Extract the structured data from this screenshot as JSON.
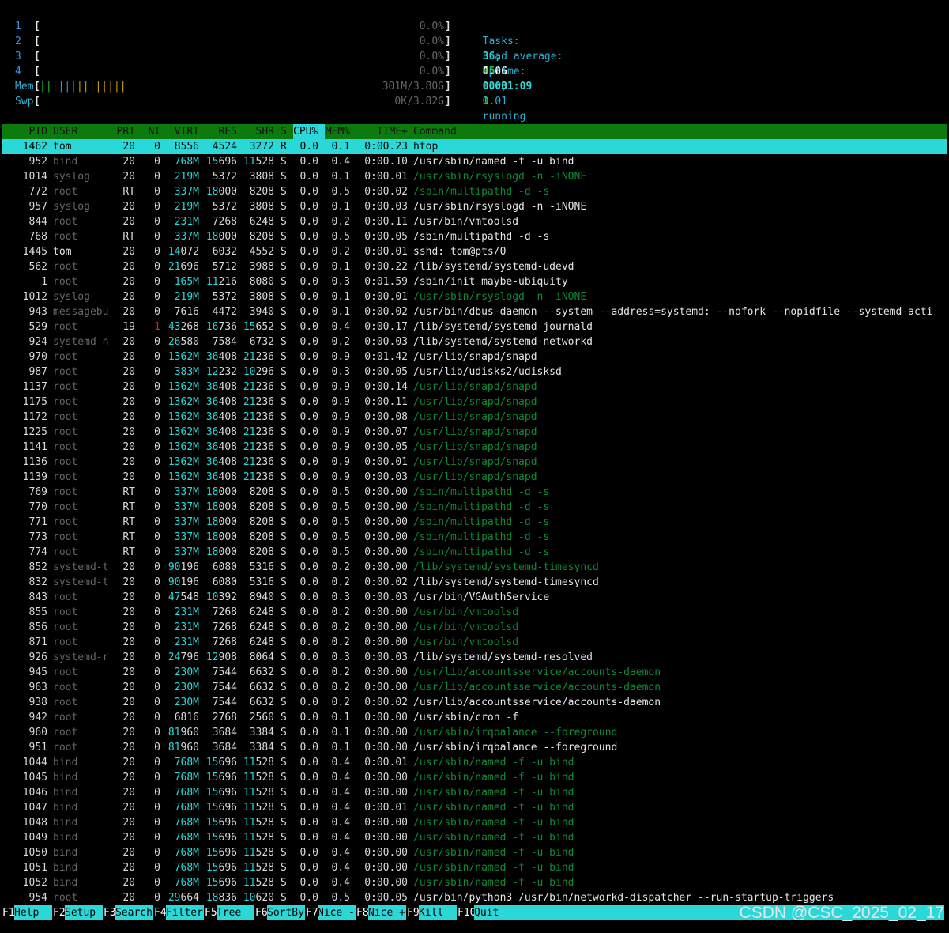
{
  "cpus": [
    {
      "num": "1",
      "pct": "0.0%"
    },
    {
      "num": "2",
      "pct": "0.0%"
    },
    {
      "num": "3",
      "pct": "0.0%"
    },
    {
      "num": "4",
      "pct": "0.0%"
    }
  ],
  "mem": {
    "label": "Mem",
    "bar": "||||||||||||||",
    "value": "301M/3.80G"
  },
  "swp": {
    "label": "Swp",
    "value": "0K/3.82G"
  },
  "tasks": {
    "label": "Tasks:",
    "tasks": "36,",
    "thr": "45",
    "thr_label": "thr;",
    "running": "1",
    "running_label": "running"
  },
  "load": {
    "label": "Load average:",
    "l1": "0.06",
    "l5": "0.03",
    "l15": "0.01"
  },
  "uptime": {
    "label": "Uptime:",
    "value": "00:01:09"
  },
  "columns": [
    "PID",
    "USER",
    "PRI",
    "NI",
    "VIRT",
    "RES",
    "SHR",
    "S",
    "CPU%",
    "MEM%",
    "TIME+",
    "Command"
  ],
  "processes": [
    {
      "pid": "1462",
      "user": "tom",
      "pri": "20",
      "ni": "0",
      "virt": "8556",
      "res": "4524",
      "shr": "3272",
      "s": "R",
      "cpu": "0.0",
      "mem": "0.1",
      "time": "0:00.23",
      "cmd": "htop",
      "sel": true
    },
    {
      "pid": "952",
      "user": "bind",
      "pri": "20",
      "ni": "0",
      "virt": "768M",
      "res": "15696",
      "shr": "11528",
      "s": "S",
      "cpu": "0.0",
      "mem": "0.4",
      "time": "0:00.10",
      "cmd": "/usr/sbin/named -f -u bind"
    },
    {
      "pid": "1014",
      "user": "syslog",
      "pri": "20",
      "ni": "0",
      "virt": "219M",
      "res": "5372",
      "shr": "3808",
      "s": "S",
      "cpu": "0.0",
      "mem": "0.1",
      "time": "0:00.01",
      "cmd": "/usr/sbin/rsyslogd -n -iNONE",
      "thread": true
    },
    {
      "pid": "772",
      "user": "root",
      "pri": "RT",
      "ni": "0",
      "virt": "337M",
      "res": "18000",
      "shr": "8208",
      "s": "S",
      "cpu": "0.0",
      "mem": "0.5",
      "time": "0:00.02",
      "cmd": "/sbin/multipathd -d -s",
      "thread": true
    },
    {
      "pid": "957",
      "user": "syslog",
      "pri": "20",
      "ni": "0",
      "virt": "219M",
      "res": "5372",
      "shr": "3808",
      "s": "S",
      "cpu": "0.0",
      "mem": "0.1",
      "time": "0:00.03",
      "cmd": "/usr/sbin/rsyslogd -n -iNONE"
    },
    {
      "pid": "844",
      "user": "root",
      "pri": "20",
      "ni": "0",
      "virt": "231M",
      "res": "7268",
      "shr": "6248",
      "s": "S",
      "cpu": "0.0",
      "mem": "0.2",
      "time": "0:00.11",
      "cmd": "/usr/bin/vmtoolsd"
    },
    {
      "pid": "768",
      "user": "root",
      "pri": "RT",
      "ni": "0",
      "virt": "337M",
      "res": "18000",
      "shr": "8208",
      "s": "S",
      "cpu": "0.0",
      "mem": "0.5",
      "time": "0:00.05",
      "cmd": "/sbin/multipathd -d -s"
    },
    {
      "pid": "1445",
      "user": "tom",
      "pri": "20",
      "ni": "0",
      "virt": "14072",
      "res": "6032",
      "shr": "4552",
      "s": "S",
      "cpu": "0.0",
      "mem": "0.2",
      "time": "0:00.01",
      "cmd": "sshd: tom@pts/0"
    },
    {
      "pid": "562",
      "user": "root",
      "pri": "20",
      "ni": "0",
      "virt": "21696",
      "res": "5712",
      "shr": "3988",
      "s": "S",
      "cpu": "0.0",
      "mem": "0.1",
      "time": "0:00.22",
      "cmd": "/lib/systemd/systemd-udevd"
    },
    {
      "pid": "1",
      "user": "root",
      "pri": "20",
      "ni": "0",
      "virt": "165M",
      "res": "11216",
      "shr": "8080",
      "s": "S",
      "cpu": "0.0",
      "mem": "0.3",
      "time": "0:01.59",
      "cmd": "/sbin/init maybe-ubiquity"
    },
    {
      "pid": "1012",
      "user": "syslog",
      "pri": "20",
      "ni": "0",
      "virt": "219M",
      "res": "5372",
      "shr": "3808",
      "s": "S",
      "cpu": "0.0",
      "mem": "0.1",
      "time": "0:00.01",
      "cmd": "/usr/sbin/rsyslogd -n -iNONE",
      "thread": true
    },
    {
      "pid": "943",
      "user": "messagebu",
      "pri": "20",
      "ni": "0",
      "virt": "7616",
      "res": "4472",
      "shr": "3940",
      "s": "S",
      "cpu": "0.0",
      "mem": "0.1",
      "time": "0:00.02",
      "cmd": "/usr/bin/dbus-daemon --system --address=systemd: --nofork --nopidfile --systemd-acti"
    },
    {
      "pid": "529",
      "user": "root",
      "pri": "19",
      "ni": "-1",
      "virt": "43268",
      "res": "16736",
      "shr": "15652",
      "s": "S",
      "cpu": "0.0",
      "mem": "0.4",
      "time": "0:00.17",
      "cmd": "/lib/systemd/systemd-journald"
    },
    {
      "pid": "924",
      "user": "systemd-n",
      "pri": "20",
      "ni": "0",
      "virt": "26580",
      "res": "7584",
      "shr": "6732",
      "s": "S",
      "cpu": "0.0",
      "mem": "0.2",
      "time": "0:00.03",
      "cmd": "/lib/systemd/systemd-networkd"
    },
    {
      "pid": "970",
      "user": "root",
      "pri": "20",
      "ni": "0",
      "virt": "1362M",
      "res": "36408",
      "shr": "21236",
      "s": "S",
      "cpu": "0.0",
      "mem": "0.9",
      "time": "0:01.42",
      "cmd": "/usr/lib/snapd/snapd"
    },
    {
      "pid": "987",
      "user": "root",
      "pri": "20",
      "ni": "0",
      "virt": "383M",
      "res": "12232",
      "shr": "10296",
      "s": "S",
      "cpu": "0.0",
      "mem": "0.3",
      "time": "0:00.05",
      "cmd": "/usr/lib/udisks2/udisksd"
    },
    {
      "pid": "1137",
      "user": "root",
      "pri": "20",
      "ni": "0",
      "virt": "1362M",
      "res": "36408",
      "shr": "21236",
      "s": "S",
      "cpu": "0.0",
      "mem": "0.9",
      "time": "0:00.14",
      "cmd": "/usr/lib/snapd/snapd",
      "thread": true
    },
    {
      "pid": "1175",
      "user": "root",
      "pri": "20",
      "ni": "0",
      "virt": "1362M",
      "res": "36408",
      "shr": "21236",
      "s": "S",
      "cpu": "0.0",
      "mem": "0.9",
      "time": "0:00.11",
      "cmd": "/usr/lib/snapd/snapd",
      "thread": true
    },
    {
      "pid": "1172",
      "user": "root",
      "pri": "20",
      "ni": "0",
      "virt": "1362M",
      "res": "36408",
      "shr": "21236",
      "s": "S",
      "cpu": "0.0",
      "mem": "0.9",
      "time": "0:00.08",
      "cmd": "/usr/lib/snapd/snapd",
      "thread": true
    },
    {
      "pid": "1225",
      "user": "root",
      "pri": "20",
      "ni": "0",
      "virt": "1362M",
      "res": "36408",
      "shr": "21236",
      "s": "S",
      "cpu": "0.0",
      "mem": "0.9",
      "time": "0:00.07",
      "cmd": "/usr/lib/snapd/snapd",
      "thread": true
    },
    {
      "pid": "1141",
      "user": "root",
      "pri": "20",
      "ni": "0",
      "virt": "1362M",
      "res": "36408",
      "shr": "21236",
      "s": "S",
      "cpu": "0.0",
      "mem": "0.9",
      "time": "0:00.05",
      "cmd": "/usr/lib/snapd/snapd",
      "thread": true
    },
    {
      "pid": "1136",
      "user": "root",
      "pri": "20",
      "ni": "0",
      "virt": "1362M",
      "res": "36408",
      "shr": "21236",
      "s": "S",
      "cpu": "0.0",
      "mem": "0.9",
      "time": "0:00.01",
      "cmd": "/usr/lib/snapd/snapd",
      "thread": true
    },
    {
      "pid": "1139",
      "user": "root",
      "pri": "20",
      "ni": "0",
      "virt": "1362M",
      "res": "36408",
      "shr": "21236",
      "s": "S",
      "cpu": "0.0",
      "mem": "0.9",
      "time": "0:00.03",
      "cmd": "/usr/lib/snapd/snapd",
      "thread": true
    },
    {
      "pid": "769",
      "user": "root",
      "pri": "RT",
      "ni": "0",
      "virt": "337M",
      "res": "18000",
      "shr": "8208",
      "s": "S",
      "cpu": "0.0",
      "mem": "0.5",
      "time": "0:00.00",
      "cmd": "/sbin/multipathd -d -s",
      "thread": true
    },
    {
      "pid": "770",
      "user": "root",
      "pri": "RT",
      "ni": "0",
      "virt": "337M",
      "res": "18000",
      "shr": "8208",
      "s": "S",
      "cpu": "0.0",
      "mem": "0.5",
      "time": "0:00.00",
      "cmd": "/sbin/multipathd -d -s",
      "thread": true
    },
    {
      "pid": "771",
      "user": "root",
      "pri": "RT",
      "ni": "0",
      "virt": "337M",
      "res": "18000",
      "shr": "8208",
      "s": "S",
      "cpu": "0.0",
      "mem": "0.5",
      "time": "0:00.00",
      "cmd": "/sbin/multipathd -d -s",
      "thread": true
    },
    {
      "pid": "773",
      "user": "root",
      "pri": "RT",
      "ni": "0",
      "virt": "337M",
      "res": "18000",
      "shr": "8208",
      "s": "S",
      "cpu": "0.0",
      "mem": "0.5",
      "time": "0:00.00",
      "cmd": "/sbin/multipathd -d -s",
      "thread": true
    },
    {
      "pid": "774",
      "user": "root",
      "pri": "RT",
      "ni": "0",
      "virt": "337M",
      "res": "18000",
      "shr": "8208",
      "s": "S",
      "cpu": "0.0",
      "mem": "0.5",
      "time": "0:00.00",
      "cmd": "/sbin/multipathd -d -s",
      "thread": true
    },
    {
      "pid": "852",
      "user": "systemd-t",
      "pri": "20",
      "ni": "0",
      "virt": "90196",
      "res": "6080",
      "shr": "5316",
      "s": "S",
      "cpu": "0.0",
      "mem": "0.2",
      "time": "0:00.00",
      "cmd": "/lib/systemd/systemd-timesyncd",
      "thread": true
    },
    {
      "pid": "832",
      "user": "systemd-t",
      "pri": "20",
      "ni": "0",
      "virt": "90196",
      "res": "6080",
      "shr": "5316",
      "s": "S",
      "cpu": "0.0",
      "mem": "0.2",
      "time": "0:00.02",
      "cmd": "/lib/systemd/systemd-timesyncd"
    },
    {
      "pid": "843",
      "user": "root",
      "pri": "20",
      "ni": "0",
      "virt": "47548",
      "res": "10392",
      "shr": "8940",
      "s": "S",
      "cpu": "0.0",
      "mem": "0.3",
      "time": "0:00.03",
      "cmd": "/usr/bin/VGAuthService"
    },
    {
      "pid": "855",
      "user": "root",
      "pri": "20",
      "ni": "0",
      "virt": "231M",
      "res": "7268",
      "shr": "6248",
      "s": "S",
      "cpu": "0.0",
      "mem": "0.2",
      "time": "0:00.00",
      "cmd": "/usr/bin/vmtoolsd",
      "thread": true
    },
    {
      "pid": "856",
      "user": "root",
      "pri": "20",
      "ni": "0",
      "virt": "231M",
      "res": "7268",
      "shr": "6248",
      "s": "S",
      "cpu": "0.0",
      "mem": "0.2",
      "time": "0:00.00",
      "cmd": "/usr/bin/vmtoolsd",
      "thread": true
    },
    {
      "pid": "871",
      "user": "root",
      "pri": "20",
      "ni": "0",
      "virt": "231M",
      "res": "7268",
      "shr": "6248",
      "s": "S",
      "cpu": "0.0",
      "mem": "0.2",
      "time": "0:00.00",
      "cmd": "/usr/bin/vmtoolsd",
      "thread": true
    },
    {
      "pid": "926",
      "user": "systemd-r",
      "pri": "20",
      "ni": "0",
      "virt": "24796",
      "res": "12908",
      "shr": "8064",
      "s": "S",
      "cpu": "0.0",
      "mem": "0.3",
      "time": "0:00.03",
      "cmd": "/lib/systemd/systemd-resolved"
    },
    {
      "pid": "945",
      "user": "root",
      "pri": "20",
      "ni": "0",
      "virt": "230M",
      "res": "7544",
      "shr": "6632",
      "s": "S",
      "cpu": "0.0",
      "mem": "0.2",
      "time": "0:00.00",
      "cmd": "/usr/lib/accountsservice/accounts-daemon",
      "thread": true
    },
    {
      "pid": "963",
      "user": "root",
      "pri": "20",
      "ni": "0",
      "virt": "230M",
      "res": "7544",
      "shr": "6632",
      "s": "S",
      "cpu": "0.0",
      "mem": "0.2",
      "time": "0:00.00",
      "cmd": "/usr/lib/accountsservice/accounts-daemon",
      "thread": true
    },
    {
      "pid": "938",
      "user": "root",
      "pri": "20",
      "ni": "0",
      "virt": "230M",
      "res": "7544",
      "shr": "6632",
      "s": "S",
      "cpu": "0.0",
      "mem": "0.2",
      "time": "0:00.02",
      "cmd": "/usr/lib/accountsservice/accounts-daemon"
    },
    {
      "pid": "942",
      "user": "root",
      "pri": "20",
      "ni": "0",
      "virt": "6816",
      "res": "2768",
      "shr": "2560",
      "s": "S",
      "cpu": "0.0",
      "mem": "0.1",
      "time": "0:00.00",
      "cmd": "/usr/sbin/cron -f"
    },
    {
      "pid": "960",
      "user": "root",
      "pri": "20",
      "ni": "0",
      "virt": "81960",
      "res": "3684",
      "shr": "3384",
      "s": "S",
      "cpu": "0.0",
      "mem": "0.1",
      "time": "0:00.00",
      "cmd": "/usr/sbin/irqbalance --foreground",
      "thread": true
    },
    {
      "pid": "951",
      "user": "root",
      "pri": "20",
      "ni": "0",
      "virt": "81960",
      "res": "3684",
      "shr": "3384",
      "s": "S",
      "cpu": "0.0",
      "mem": "0.1",
      "time": "0:00.00",
      "cmd": "/usr/sbin/irqbalance --foreground"
    },
    {
      "pid": "1044",
      "user": "bind",
      "pri": "20",
      "ni": "0",
      "virt": "768M",
      "res": "15696",
      "shr": "11528",
      "s": "S",
      "cpu": "0.0",
      "mem": "0.4",
      "time": "0:00.01",
      "cmd": "/usr/sbin/named -f -u bind",
      "thread": true
    },
    {
      "pid": "1045",
      "user": "bind",
      "pri": "20",
      "ni": "0",
      "virt": "768M",
      "res": "15696",
      "shr": "11528",
      "s": "S",
      "cpu": "0.0",
      "mem": "0.4",
      "time": "0:00.00",
      "cmd": "/usr/sbin/named -f -u bind",
      "thread": true
    },
    {
      "pid": "1046",
      "user": "bind",
      "pri": "20",
      "ni": "0",
      "virt": "768M",
      "res": "15696",
      "shr": "11528",
      "s": "S",
      "cpu": "0.0",
      "mem": "0.4",
      "time": "0:00.00",
      "cmd": "/usr/sbin/named -f -u bind",
      "thread": true
    },
    {
      "pid": "1047",
      "user": "bind",
      "pri": "20",
      "ni": "0",
      "virt": "768M",
      "res": "15696",
      "shr": "11528",
      "s": "S",
      "cpu": "0.0",
      "mem": "0.4",
      "time": "0:00.01",
      "cmd": "/usr/sbin/named -f -u bind",
      "thread": true
    },
    {
      "pid": "1048",
      "user": "bind",
      "pri": "20",
      "ni": "0",
      "virt": "768M",
      "res": "15696",
      "shr": "11528",
      "s": "S",
      "cpu": "0.0",
      "mem": "0.4",
      "time": "0:00.00",
      "cmd": "/usr/sbin/named -f -u bind",
      "thread": true
    },
    {
      "pid": "1049",
      "user": "bind",
      "pri": "20",
      "ni": "0",
      "virt": "768M",
      "res": "15696",
      "shr": "11528",
      "s": "S",
      "cpu": "0.0",
      "mem": "0.4",
      "time": "0:00.00",
      "cmd": "/usr/sbin/named -f -u bind",
      "thread": true
    },
    {
      "pid": "1050",
      "user": "bind",
      "pri": "20",
      "ni": "0",
      "virt": "768M",
      "res": "15696",
      "shr": "11528",
      "s": "S",
      "cpu": "0.0",
      "mem": "0.4",
      "time": "0:00.00",
      "cmd": "/usr/sbin/named -f -u bind",
      "thread": true
    },
    {
      "pid": "1051",
      "user": "bind",
      "pri": "20",
      "ni": "0",
      "virt": "768M",
      "res": "15696",
      "shr": "11528",
      "s": "S",
      "cpu": "0.0",
      "mem": "0.4",
      "time": "0:00.00",
      "cmd": "/usr/sbin/named -f -u bind",
      "thread": true
    },
    {
      "pid": "1052",
      "user": "bind",
      "pri": "20",
      "ni": "0",
      "virt": "768M",
      "res": "15696",
      "shr": "11528",
      "s": "S",
      "cpu": "0.0",
      "mem": "0.4",
      "time": "0:00.00",
      "cmd": "/usr/sbin/named -f -u bind",
      "thread": true
    },
    {
      "pid": "954",
      "user": "root",
      "pri": "20",
      "ni": "0",
      "virt": "29664",
      "res": "18836",
      "shr": "10620",
      "s": "S",
      "cpu": "0.0",
      "mem": "0.5",
      "time": "0:00.05",
      "cmd": "/usr/bin/python3 /usr/bin/networkd-dispatcher --run-startup-triggers"
    }
  ],
  "function_keys": [
    {
      "key": "F1",
      "label": "Help"
    },
    {
      "key": "F2",
      "label": "Setup"
    },
    {
      "key": "F3",
      "label": "Search"
    },
    {
      "key": "F4",
      "label": "Filter"
    },
    {
      "key": "F5",
      "label": "Tree"
    },
    {
      "key": "F6",
      "label": "SortBy"
    },
    {
      "key": "F7",
      "label": "Nice -"
    },
    {
      "key": "F8",
      "label": "Nice +"
    },
    {
      "key": "F9",
      "label": "Kill"
    },
    {
      "key": "F10",
      "label": "Quit"
    }
  ],
  "watermark": "CSDN @CSC_2025_02_17",
  "colors": {
    "header_bg": "#0c7a0c",
    "selected_bg": "#2ad8d8",
    "sort_col_bg": "#2ad8d8",
    "thread_cmd": "#0e8a35"
  }
}
